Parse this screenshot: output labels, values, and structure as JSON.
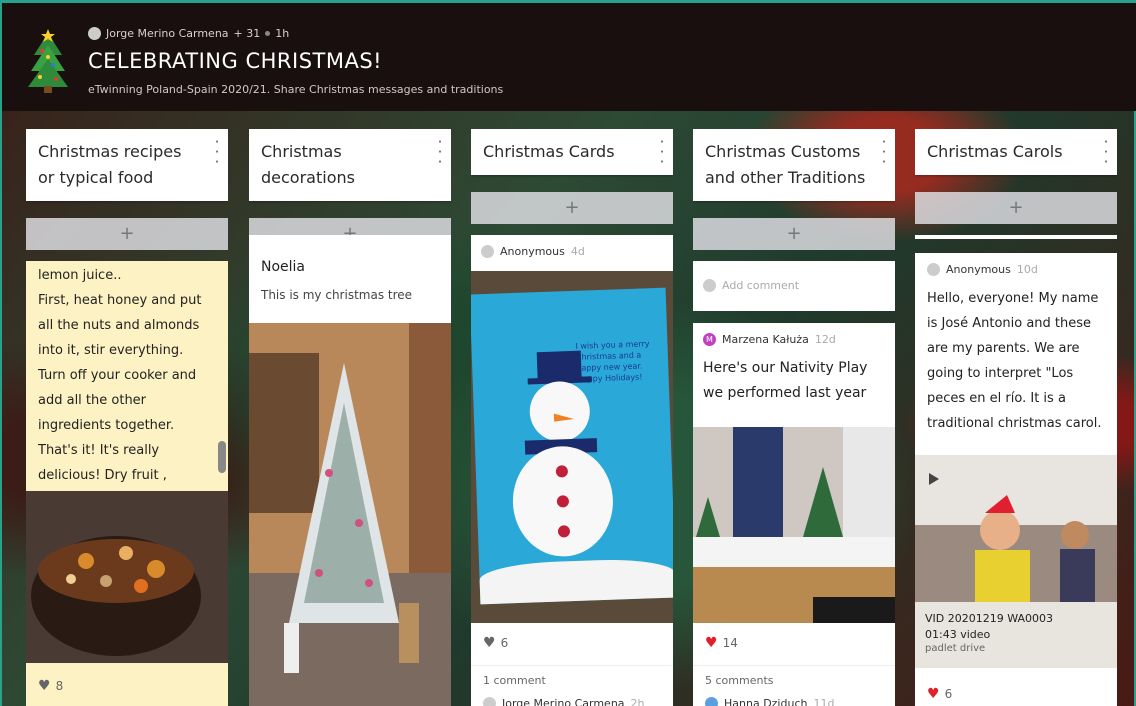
{
  "header": {
    "author": "Jorge Merino Carmena",
    "contributors": "+ 31",
    "time": "1h",
    "title": "CELEBRATING CHRISTMAS!",
    "subtitle": "eTwinning Poland-Spain 2020/21. Share Christmas messages and traditions"
  },
  "columns": [
    {
      "title": "Christmas recipes or typical food",
      "add": "+"
    },
    {
      "title": "Christmas decorations",
      "add": "+"
    },
    {
      "title": "Christmas Cards",
      "add": "+"
    },
    {
      "title": "Christmas Customs and other Traditions",
      "add": "+"
    },
    {
      "title": "Christmas Carols",
      "add": "+"
    }
  ],
  "col1": {
    "text": "lemon juice..\nFirst, heat honey and put all the nuts and almonds into it, stir everything. Turn off your cooker and add all the other ingredients together. That's it! It's really delicious!  Dry fruit , wheat, raisins meant prosperity.",
    "likes": "8"
  },
  "col2": {
    "title": "Noelia",
    "text": "This is my christmas tree"
  },
  "col3": {
    "author": "Anonymous",
    "age": "4d",
    "card_text": "I wish you a merry Christmas and a happy new year. Happy Holidays!",
    "likes": "6",
    "comments": "1 comment",
    "commenter": "Jorge Merino Carmena",
    "commenter_age": "2h"
  },
  "col4": {
    "add_comment": "Add comment",
    "author": "Marzena Kałuża",
    "age": "12d",
    "title": "Here's our Nativity Play we performed last year",
    "likes": "14",
    "comments": "5 comments",
    "commenter": "Hanna Dziduch",
    "commenter_age": "11d"
  },
  "col5": {
    "author": "Anonymous",
    "age": "10d",
    "text": "Hello, everyone! My name is José Antonio and these are my parents. We are going to interpret \"Los peces en el río. It is a traditional christmas carol.",
    "video_name": "VID 20201219 WA0003",
    "video_meta": "01:43 video",
    "video_source": "padlet drive",
    "likes": "6"
  },
  "colors": {
    "header_bg": "#1a0f0f",
    "heart_red": "#e0202a",
    "note_yellow": "#fdf2c4",
    "accent": "#2aa18a"
  }
}
